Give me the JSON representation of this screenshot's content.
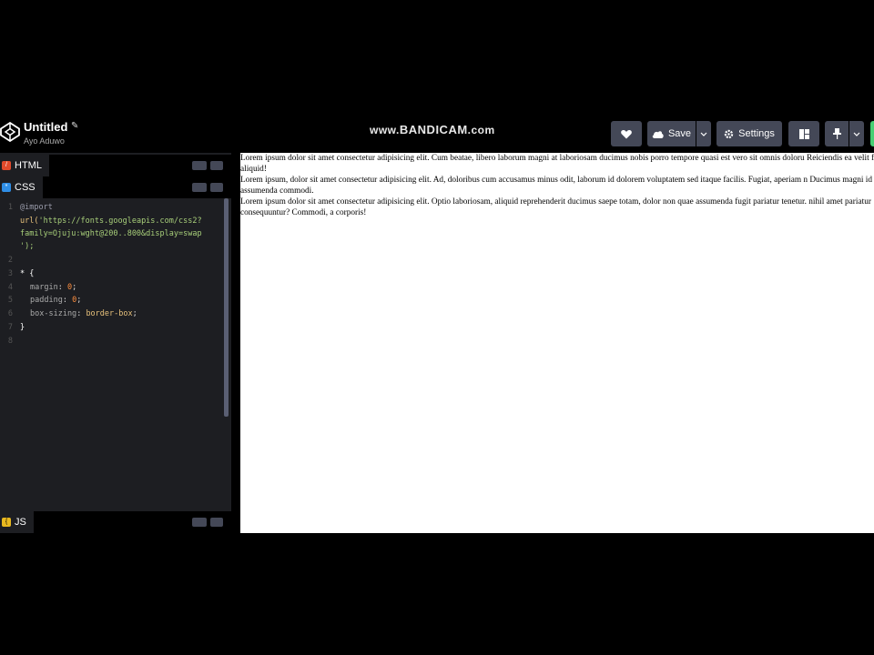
{
  "header": {
    "title": "Untitled",
    "author": "Ayo Aduwo",
    "watermark_prefix": "www.",
    "watermark_main": "BANDICAM",
    "watermark_suffix": ".com",
    "save_label": "Save",
    "settings_label": "Settings"
  },
  "editors": {
    "html_tab": "HTML",
    "css_tab": "CSS",
    "js_tab": "JS"
  },
  "css_code": {
    "line1_kw": "@import",
    "line2_fn": "url(",
    "line2_str": "'https://fonts.googleapis.com/css2?",
    "line3_str": "family=Ojuju:wght@200..800&display=swap",
    "line4": "');",
    "line6": "* {",
    "line7_prop": "margin",
    "line7_val": "0",
    "line8_prop": "padding",
    "line8_val": "0",
    "line9_prop": "box-sizing",
    "line9_val": "border-box",
    "line10": "}"
  },
  "preview": {
    "paragraphs": [
      "Lorem ipsum dolor sit amet consectetur adipisicing elit. Cum beatae, libero laborum magni at laboriosam ducimus nobis porro tempore quasi est vero sit omnis doloru Reiciendis ea velit fugiat aliquid!",
      "Lorem ipsum, dolor sit amet consectetur adipisicing elit. Ad, doloribus cum accusamus minus odit, laborum id dolorem voluptatem sed itaque facilis. Fugiat, aperiam n Ducimus magni id ipsum assumenda commodi.",
      "Lorem ipsum dolor sit amet consectetur adipisicing elit. Optio laboriosam, aliquid reprehenderit ducimus saepe totam, dolor non quae assumenda fugit pariatur tenetur. nihil amet pariatur consequuntur? Commodi, a corporis!"
    ]
  },
  "colors": {
    "html_badge": "#e24a2b",
    "css_badge": "#2f8ee6",
    "js_badge": "#e8b81f",
    "button_bg": "#444857"
  }
}
